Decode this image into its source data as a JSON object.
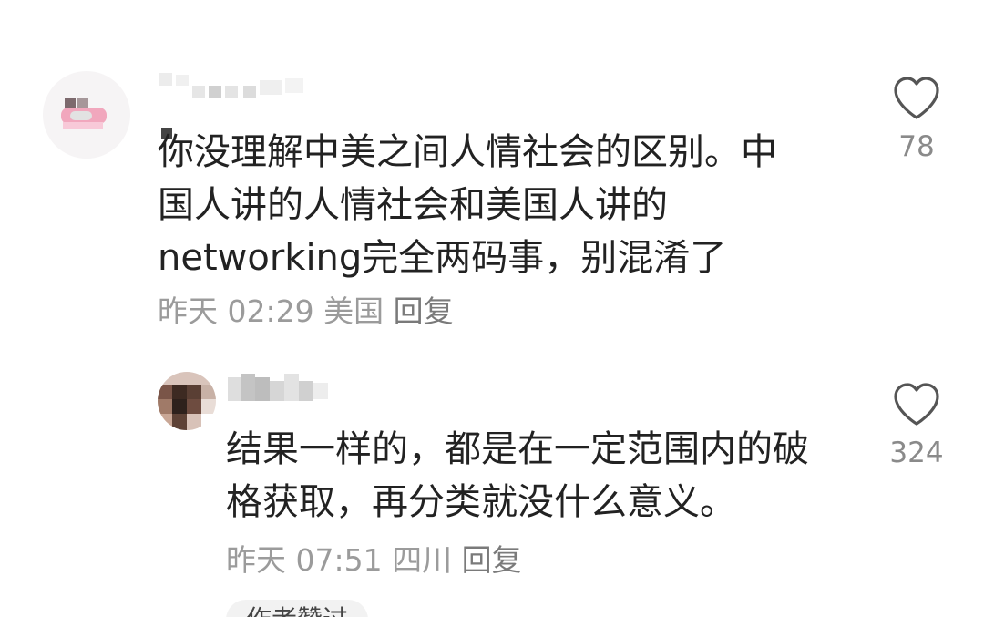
{
  "comments": [
    {
      "text": "你没理解中美之间人情社会的区别。中\n国人讲的人情社会和美国人讲的\nnetworking完全两码事，别混淆了",
      "time": "昨天 02:29",
      "location": "美国",
      "reply_label": "回复",
      "likes": "78",
      "heart_icon": "heart-outline-icon"
    },
    {
      "text": "结果一样的，都是在一定范围内的破\n格获取，再分类就没什么意义。",
      "time": "昨天 07:51",
      "location": "四川",
      "reply_label": "回复",
      "likes": "324",
      "heart_icon": "heart-outline-icon"
    }
  ],
  "footer_chip": "作者赞过"
}
